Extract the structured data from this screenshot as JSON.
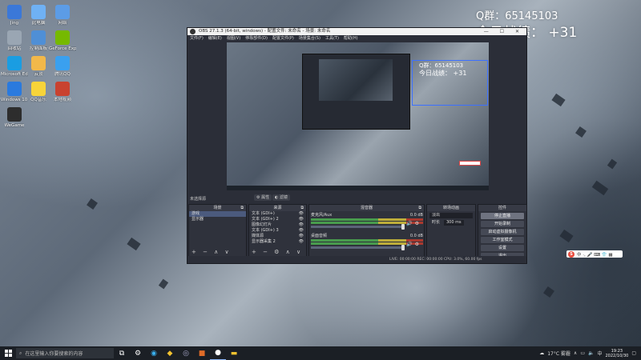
{
  "overlay": {
    "qq_line": "Q群：65145103",
    "score_line": "今日战绩：  +31"
  },
  "desktop_icons": [
    {
      "id": "jing",
      "label": "Jing",
      "color": "#3b78d8"
    },
    {
      "id": "pc",
      "label": "此电脑",
      "color": "#6fb1f4"
    },
    {
      "id": "network",
      "label": "网络",
      "color": "#5c9ce6"
    },
    {
      "id": "recycle",
      "label": "回收站",
      "color": "#9aa6b3"
    },
    {
      "id": "control",
      "label": "控制面板",
      "color": "#4f8fd6"
    },
    {
      "id": "geforce",
      "label": "GeForce Experience",
      "color": "#76b900"
    },
    {
      "id": "edge",
      "label": "Microsoft Edge",
      "color": "#1a9de2"
    },
    {
      "id": "yuanshen",
      "label": "云顶",
      "color": "#f2b84a"
    },
    {
      "id": "tencent",
      "label": "腾讯QQ",
      "color": "#3aa0ef"
    },
    {
      "id": "windows",
      "label": "Windows 10 易升",
      "color": "#2a7ade"
    },
    {
      "id": "qq",
      "label": "QQ音乐",
      "color": "#f7d43a"
    },
    {
      "id": "wallpaper",
      "label": "本地视频",
      "color": "#c9422f"
    },
    {
      "id": "wegame",
      "label": "WeGame",
      "color": "#2d2d2d"
    }
  ],
  "obs": {
    "title": "OBS 27.1.3 (64-bit, windows) - 配置文件: 未命名 - 场景: 未命名",
    "window_buttons": "—  ☐  ✕",
    "menu": [
      "文件(F)",
      "编辑(E)",
      "视图(V)",
      "停靠部件(D)",
      "配置文件(P)",
      "场景集合(S)",
      "工具(T)",
      "帮助(H)"
    ],
    "preview_overlay_qq": "Q群：65145103",
    "preview_overlay_score": "今日战绩：  +31",
    "scene_label": "未选择源",
    "btn_properties": "⚙ 属性",
    "btn_filters": "◐ 滤镜",
    "scenes": {
      "title": "场景",
      "items": [
        "游戏",
        "显示器"
      ],
      "footer": "+ − ∧ ∨"
    },
    "sources": {
      "title": "来源",
      "items": [
        "文本 (GDI+)",
        "文本 (GDI+) 2",
        "图像幻灯片",
        "文本 (GDI+) 3",
        "媒体源",
        "显示器采集 2"
      ],
      "footer": "+ − ⚙ ∧ ∨"
    },
    "mixer": {
      "title": "混音器",
      "channels": [
        {
          "name": "麦克风/Aux",
          "db": "0.0 dB"
        },
        {
          "name": "桌面音频",
          "db": "0.0 dB"
        }
      ]
    },
    "transitions": {
      "title": "转场动画",
      "type": "淡出",
      "duration_label": "时长",
      "duration_value": "300 ms"
    },
    "controls": {
      "title": "控件",
      "buttons": [
        "停止直播",
        "开始录制",
        "启动虚拟摄像机",
        "工作室模式",
        "设置",
        "退出"
      ]
    },
    "status": "LIVE: 00:00:00    REC: 00:00:00    CPU: 3.0%, 60.00 fps"
  },
  "ime": {
    "logo": "S",
    "items": "中 ·, 🎤 ⌨ 👕 ▦"
  },
  "taskbar": {
    "search_placeholder": "在这里输入你要搜索的内容",
    "weather": "17°C 雾霾",
    "time": "19:23",
    "date": "2022/10/30",
    "lang": "中"
  }
}
